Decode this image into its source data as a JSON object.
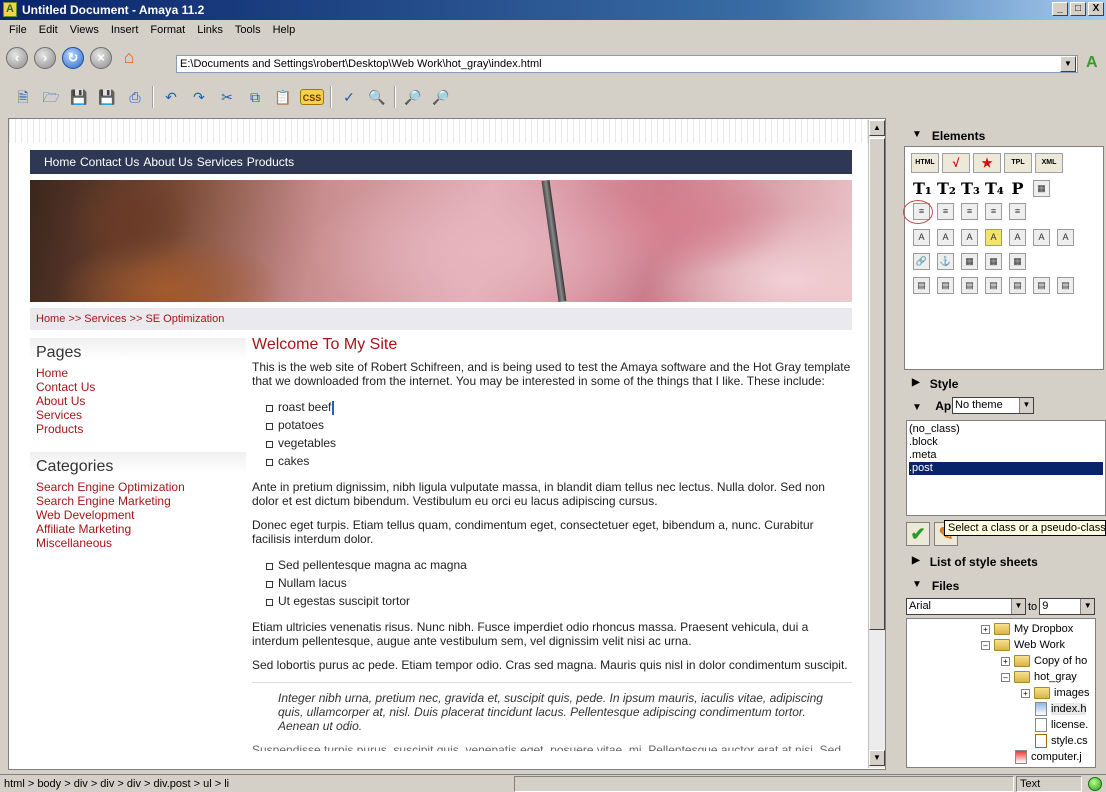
{
  "window": {
    "title": "Untitled Document - Amaya 11.2",
    "controls": [
      "_",
      "□",
      "X"
    ]
  },
  "menu": [
    "File",
    "Edit",
    "Views",
    "Insert",
    "Format",
    "Links",
    "Tools",
    "Help"
  ],
  "nav": {
    "url": "E:\\Documents and Settings\\robert\\Desktop\\Web Work\\hot_gray\\index.html"
  },
  "toolbar": {
    "css_label": "CSS"
  },
  "doc": {
    "topnav": [
      "Home",
      "Contact Us",
      "About Us",
      "Services",
      "Products"
    ],
    "breadcrumb": "Home >> Services >> SE Optimization",
    "pages_title": "Pages",
    "pages_links": [
      "Home",
      "Contact Us",
      "About Us",
      "Services",
      "Products"
    ],
    "categories_title": "Categories",
    "categories_links": [
      "Search Engine Optimization",
      "Search Engine Marketing",
      "Web Development",
      "Affiliate Marketing",
      "Miscellaneous"
    ],
    "heading": "Welcome To My Site",
    "intro": "This is the web site of Robert Schifreen, and is being used to test the Amaya software and the Hot Gray template that we downloaded from the internet. You may be interested in some of the things that I like. These include:",
    "list1": [
      "roast beef",
      "potatoes",
      "vegetables",
      "cakes"
    ],
    "para2": "Ante in pretium dignissim, nibh ligula vulputate massa, in blandit diam tellus nec lectus. Nulla dolor. Sed non dolor et est dictum bibendum. Vestibulum eu orci eu lacus adipiscing cursus.",
    "para3": "Donec eget turpis. Etiam tellus quam, condimentum eget, consectetuer eget, bibendum a, nunc. Curabitur facilisis interdum dolor.",
    "list2": [
      "Sed pellentesque magna ac magna",
      "Nullam lacus",
      "Ut egestas suscipit tortor"
    ],
    "para4": "Etiam ultricies venenatis risus. Nunc nibh. Fusce imperdiet odio rhoncus massa. Praesent vehicula, dui a interdum pellentesque, augue ante vestibulum sem, vel dignissim velit nisi ac urna.",
    "para5": "Sed lobortis purus ac pede. Etiam tempor odio. Cras sed magna. Mauris quis nisl in dolor condimentum suscipit.",
    "quote": "Integer nibh urna, pretium nec, gravida et, suscipit quis, pede. In ipsum mauris, iaculis vitae, adipiscing quis, ullamcorper at, nisl. Duis placerat tincidunt lacus. Pellentesque adipiscing condimentum tortor. Aenean ut odio.",
    "cutoff": "Suspendisse turpis purus, suscipit quis, venenatis eget, posuere vitae, mi. Pellentesque auctor erat at nisi. Sed"
  },
  "panel": {
    "elements_title": "Elements",
    "element_tabs": [
      "HTML",
      "XML",
      "TPL"
    ],
    "style_title": "Style",
    "apply_title": "Ap",
    "theme_value": "No theme",
    "classes": [
      "(no_class)",
      ".block",
      ".meta",
      ".post"
    ],
    "selected_class": ".post",
    "tooltip": "Select a class or a pseudo-class",
    "stylesheets_title": "List of style sheets",
    "files_title": "Files",
    "font_family": "Arial",
    "font_to": "to",
    "font_size": "9",
    "tree": [
      "My Dropbox",
      "Web Work",
      "Copy of ho",
      "hot_gray",
      "images",
      "index.h",
      "license.",
      "style.cs",
      "computer.j"
    ]
  },
  "status": {
    "path": "html > body > div > div > div > div.post > ul > li",
    "mode": "Text"
  }
}
